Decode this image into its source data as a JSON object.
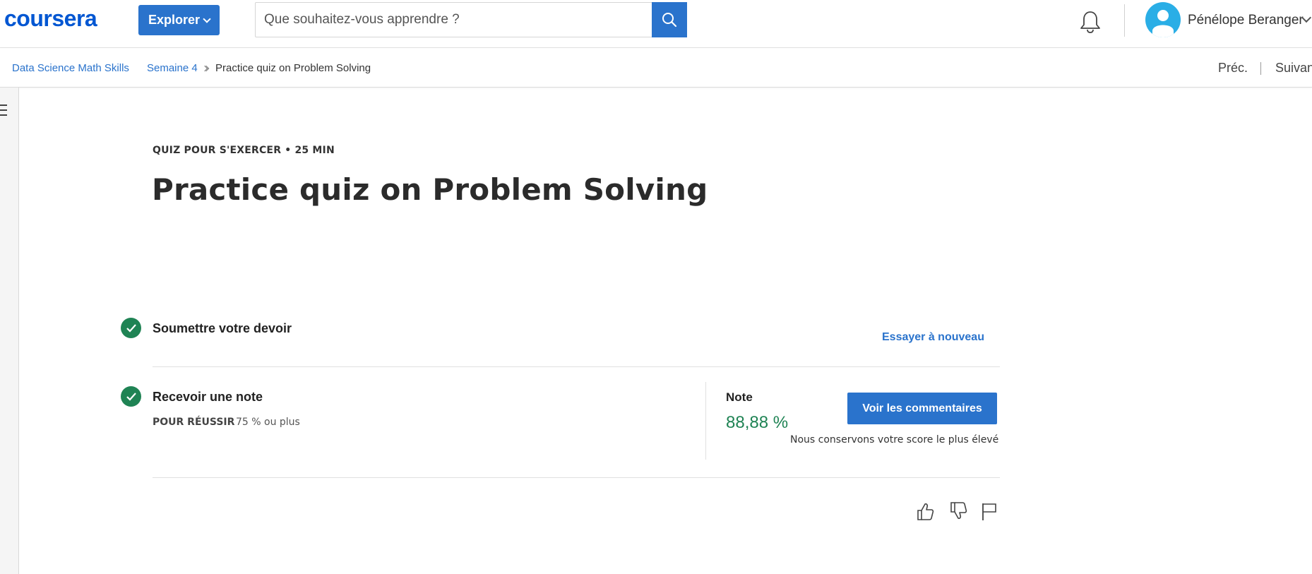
{
  "header": {
    "logo": "coursera",
    "explore_label": "Explorer",
    "search_placeholder": "Que souhaitez-vous apprendre ?",
    "user_name": "Pénélope Beranger",
    "icons": [
      "search-icon",
      "bell-icon",
      "avatar-icon",
      "chevron-down-icon"
    ]
  },
  "breadcrumb": {
    "items": [
      "Data Science Math Skills",
      "Semaine 4",
      "Practice quiz on Problem Solving"
    ],
    "prev_label": "Préc.",
    "next_label": "Suivant"
  },
  "quiz": {
    "kicker": "QUIZ POUR S'EXERCER • 25  MIN",
    "title": "Practice quiz on Problem Solving",
    "step1_title": "Soumettre votre devoir",
    "retry_label": "Essayer à nouveau",
    "step2_title": "Recevoir une note",
    "pass_label": "POUR RÉUSSIR",
    "pass_value": "75 % ou plus",
    "grade_label": "Note",
    "grade_value": "88,88 %",
    "feedback_button": "Voir les commentaires",
    "score_note": "Nous conservons votre score le plus élevé"
  },
  "colors": {
    "brand": "#0056d2",
    "primary": "#2a73cc",
    "success": "#1f8354"
  }
}
